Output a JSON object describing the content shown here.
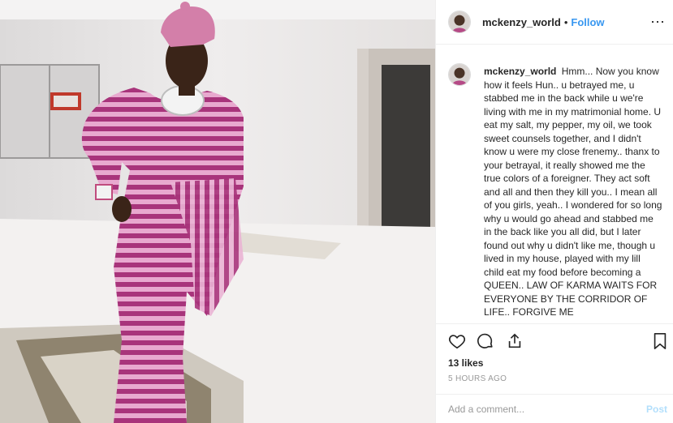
{
  "post": {
    "username": "mckenzy_world",
    "separator": "•",
    "follow_label": "Follow",
    "more_label": "⋯"
  },
  "caption": {
    "username": "mckenzy_world",
    "text": "Hmm... Now you know how it feels Hun.. u betrayed me, u stabbed me in the back while u we're living with me in my matrimonial home. U eat my salt, my pepper, my oil, we took sweet counsels together, and I didn't know u were my close frenemy.. thanx to your betrayal, it really showed me the true colors of a foreigner. They act soft and all and then they kill you.. I mean all of you girls, yeah.. I wondered for so long why u would go ahead and stabbed me in the back like you all did, but I later found out why u didn't like me, though u lived in my house, played with my lill child eat my food before becoming a QUEEN.. LAW OF KARMA WAITS FOR EVERYONE BY THE CORRIDOR OF LIFE.. FORGIVE ME"
  },
  "actions": {
    "icons": [
      "heart-icon",
      "comment-icon",
      "share-icon",
      "bookmark-icon"
    ]
  },
  "likes": "13 likes",
  "time": "5 HOURS AGO",
  "comment": {
    "placeholder": "Add a comment...",
    "post_label": "Post"
  },
  "colors": {
    "link_blue": "#3897f0",
    "post_disabled": "#b2dffc",
    "muted_text": "#999999",
    "border": "#efefef"
  }
}
